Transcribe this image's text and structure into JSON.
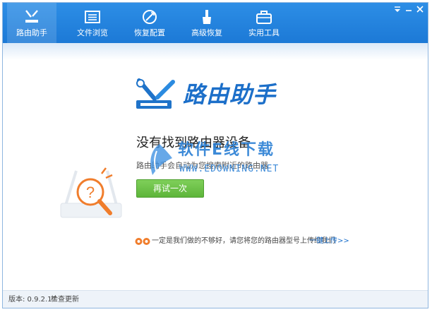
{
  "toolbar": {
    "items": [
      {
        "label": "路由助手",
        "icon": "router-tools-icon",
        "active": true
      },
      {
        "label": "文件浏览",
        "icon": "file-browser-icon",
        "active": false
      },
      {
        "label": "恢复配置",
        "icon": "restore-config-icon",
        "active": false
      },
      {
        "label": "高级恢复",
        "icon": "advanced-restore-icon",
        "active": false
      },
      {
        "label": "实用工具",
        "icon": "toolbox-icon",
        "active": false
      }
    ]
  },
  "logo": {
    "text": "路由助手"
  },
  "status": {
    "title": "没有找到路由器设备",
    "description": "路由助手会自动为您搜索附近的路由器",
    "retry_label": "再试一次"
  },
  "watermark": {
    "cn": "软件E线下载",
    "en": "WWW.EDOWNING.NET"
  },
  "feedback": {
    "text": "一定是我们做的不够好，请您将您的路由器型号上传给我们",
    "link": "一键上传>>"
  },
  "footer": {
    "version": "版本: 0.9.2.17",
    "update": "检查更新"
  },
  "colors": {
    "toolbar": "#1f7fd9",
    "accent": "#1c6fc9",
    "retry": "#6cc148",
    "icon_orange": "#f07d2c"
  }
}
